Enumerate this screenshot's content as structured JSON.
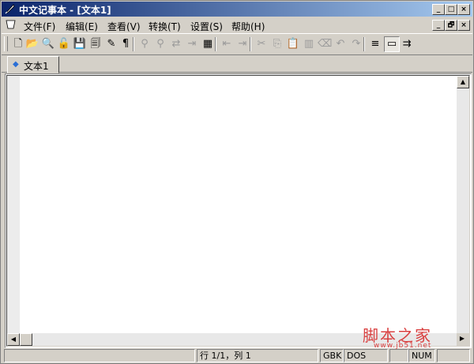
{
  "window": {
    "title": "中文记事本 - [文本1]",
    "caption_buttons": [
      "_",
      "□",
      "×"
    ],
    "mdi_buttons": [
      "_",
      "🗗",
      "×"
    ]
  },
  "menu": {
    "items": [
      {
        "label": "文件(F)"
      },
      {
        "label": "编辑(E)"
      },
      {
        "label": "查看(V)"
      },
      {
        "label": "转换(T)"
      },
      {
        "label": "设置(S)"
      },
      {
        "label": "帮助(H)"
      }
    ]
  },
  "toolbar": {
    "buttons": [
      {
        "icon": "new-document-icon",
        "glyph": "🗋",
        "enabled": true
      },
      {
        "icon": "open-folder-icon",
        "glyph": "📂",
        "enabled": true
      },
      {
        "icon": "magnifier-icon",
        "glyph": "🔍",
        "enabled": true
      },
      {
        "icon": "lock-icon",
        "glyph": "🔓",
        "enabled": true
      },
      {
        "icon": "save-icon",
        "glyph": "💾",
        "enabled": true
      },
      {
        "icon": "save-all-icon",
        "glyph": "🗐",
        "enabled": true
      },
      {
        "icon": "wrench-icon",
        "glyph": "✎",
        "enabled": true
      },
      {
        "icon": "pilcrow-icon",
        "glyph": "¶",
        "enabled": true
      },
      {
        "icon": "find-icon",
        "glyph": "⚲",
        "enabled": false
      },
      {
        "icon": "find-next-icon",
        "glyph": "⚲",
        "enabled": false
      },
      {
        "icon": "replace-icon",
        "glyph": "⇄",
        "enabled": false
      },
      {
        "icon": "goto-icon",
        "glyph": "⇥",
        "enabled": false
      },
      {
        "icon": "convert-icon",
        "glyph": "▦",
        "enabled": true
      },
      {
        "icon": "indent-icon",
        "glyph": "⇤",
        "enabled": false
      },
      {
        "icon": "outdent-icon",
        "glyph": "⇥",
        "enabled": false
      },
      {
        "icon": "cut-icon",
        "glyph": "✂",
        "enabled": false
      },
      {
        "icon": "copy-icon",
        "glyph": "⎘",
        "enabled": false
      },
      {
        "icon": "paste-icon",
        "glyph": "📋",
        "enabled": true
      },
      {
        "icon": "column-icon",
        "glyph": "▥",
        "enabled": false
      },
      {
        "icon": "delete-icon",
        "glyph": "⌫",
        "enabled": false
      },
      {
        "icon": "undo-icon",
        "glyph": "↶",
        "enabled": false
      },
      {
        "icon": "redo-icon",
        "glyph": "↷",
        "enabled": false
      },
      {
        "icon": "justify-icon",
        "glyph": "≡",
        "enabled": true
      },
      {
        "icon": "window-icon",
        "glyph": "▭",
        "enabled": true
      },
      {
        "icon": "wrap-icon",
        "glyph": "⇉",
        "enabled": true
      }
    ]
  },
  "tabs": [
    {
      "label": "文本1",
      "active": true
    }
  ],
  "statusbar": {
    "message": "",
    "position": "行 1/1，列 1",
    "encoding": "GBK",
    "line_ending": "DOS",
    "extra": "",
    "num_lock": "NUM"
  },
  "watermark": {
    "text": "脚本之家",
    "url": "www.jb51.net"
  },
  "colors": {
    "face": "#d4d0c8",
    "title_start": "#0a246a",
    "title_end": "#a6caf0",
    "editor_bg": "#ffffff",
    "watermark": "#d94040"
  }
}
